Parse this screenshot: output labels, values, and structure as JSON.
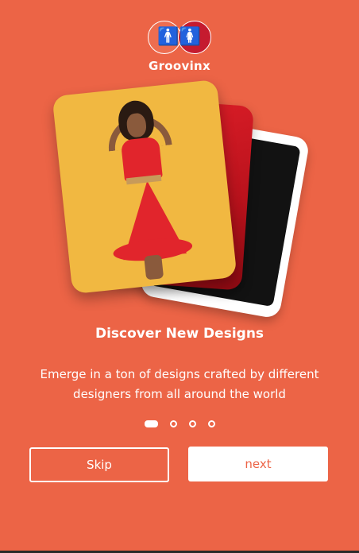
{
  "brand": {
    "name": "Groovinx",
    "logo_icons": [
      "man-figure-icon",
      "woman-figure-icon"
    ],
    "accent_color": "#EC6446",
    "logo_red": "#C51B2F"
  },
  "onboarding": {
    "title": "Discover New Designs",
    "description": "Emerge in a ton of designs crafted by different designers from all around the world",
    "page_count": 4,
    "active_page": 1
  },
  "actions": {
    "skip_label": "Skip",
    "next_label": "next"
  }
}
